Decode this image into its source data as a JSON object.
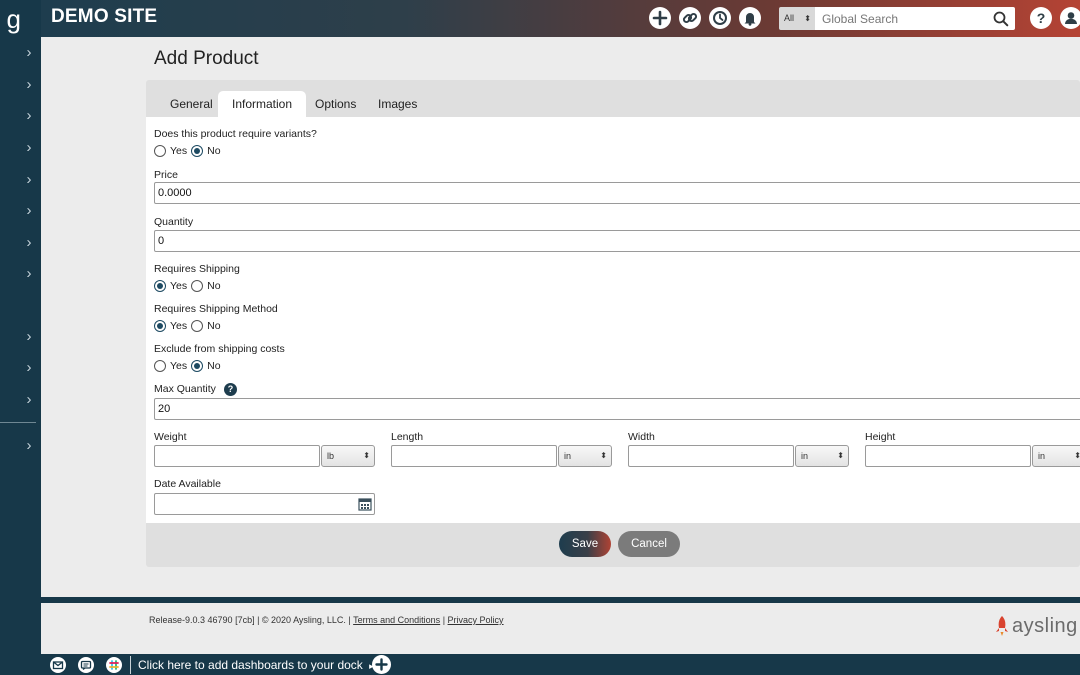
{
  "sidebar": {
    "logo_text": "g",
    "chevron": "›"
  },
  "header": {
    "site_title": "DEMO SITE",
    "icons": [
      "add-icon",
      "link-icon",
      "history-icon",
      "bell-icon",
      "help-icon",
      "user-icon"
    ],
    "search": {
      "scope_value": "All",
      "placeholder": "Global Search"
    }
  },
  "page": {
    "title": "Add Product",
    "tabs": [
      {
        "label": "General",
        "active": false
      },
      {
        "label": "Information",
        "active": true
      },
      {
        "label": "Options",
        "active": false
      },
      {
        "label": "Images",
        "active": false
      }
    ]
  },
  "form": {
    "variants": {
      "label": "Does this product require variants?",
      "yes": "Yes",
      "no": "No",
      "selected": "No"
    },
    "price": {
      "label": "Price",
      "value": "0.0000"
    },
    "quantity": {
      "label": "Quantity",
      "value": "0"
    },
    "requires_shipping": {
      "label": "Requires Shipping",
      "yes": "Yes",
      "no": "No",
      "selected": "Yes"
    },
    "requires_shipping_method": {
      "label": "Requires Shipping Method",
      "yes": "Yes",
      "no": "No",
      "selected": "Yes"
    },
    "exclude_shipping": {
      "label": "Exclude from shipping costs",
      "yes": "Yes",
      "no": "No",
      "selected": "No"
    },
    "max_quantity": {
      "label": "Max Quantity",
      "value": "20"
    },
    "weight": {
      "label": "Weight",
      "value": "",
      "unit": "lb"
    },
    "length": {
      "label": "Length",
      "value": "",
      "unit": "in"
    },
    "width": {
      "label": "Width",
      "value": "",
      "unit": "in"
    },
    "height": {
      "label": "Height",
      "value": "",
      "unit": "in"
    },
    "date_available": {
      "label": "Date Available",
      "value": ""
    },
    "save_label": "Save",
    "cancel_label": "Cancel"
  },
  "footer": {
    "release": "Release-9.0.3 46790 [7cb] | © 2020 Aysling, LLC. |",
    "terms": "Terms and Conditions",
    "sep": "|",
    "privacy": "Privacy Policy",
    "brand": "aysling"
  },
  "dock": {
    "text": "Click here to add dashboards to your dock",
    "arrow": "▸"
  },
  "colors": {
    "nav_dark": "#173849",
    "accent_red": "#b54334",
    "radio_on": "#1d4a62"
  }
}
